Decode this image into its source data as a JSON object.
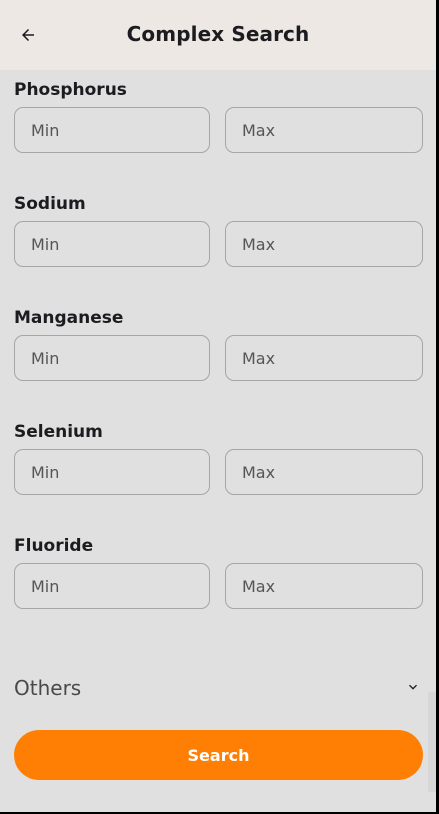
{
  "appbar": {
    "title": "Complex Search",
    "back_icon": "arrow-left-icon"
  },
  "nutrients": [
    {
      "label": "Phosphorus",
      "min_placeholder": "Min",
      "max_placeholder": "Max"
    },
    {
      "label": "Sodium",
      "min_placeholder": "Min",
      "max_placeholder": "Max"
    },
    {
      "label": "Manganese",
      "min_placeholder": "Min",
      "max_placeholder": "Max"
    },
    {
      "label": "Selenium",
      "min_placeholder": "Min",
      "max_placeholder": "Max"
    },
    {
      "label": "Fluoride",
      "min_placeholder": "Min",
      "max_placeholder": "Max"
    }
  ],
  "others": {
    "label": "Others",
    "icon": "chevron-down-icon"
  },
  "search_button": {
    "label": "Search"
  },
  "colors": {
    "accent": "#fe7f03",
    "background": "#e0e0e0",
    "appbar": "#ede8e4"
  }
}
